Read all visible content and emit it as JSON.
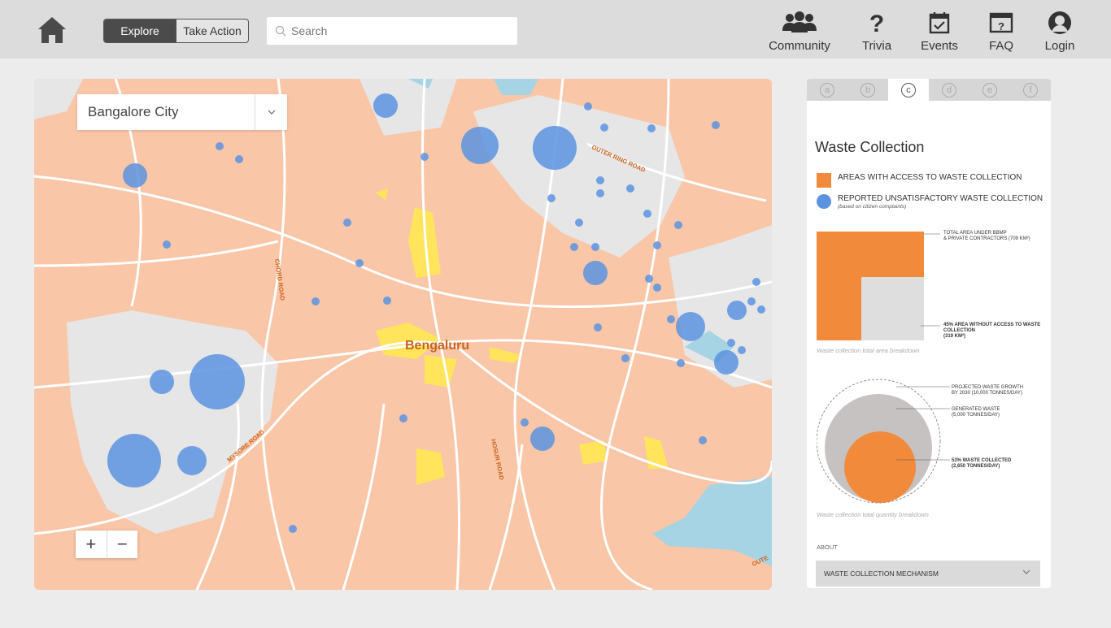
{
  "header": {
    "segment": {
      "explore": "Explore",
      "take_action": "Take Action"
    },
    "search_placeholder": "Search",
    "nav": [
      {
        "label": "Community",
        "icon": "community-icon"
      },
      {
        "label": "Trivia",
        "icon": "question-icon"
      },
      {
        "label": "Events",
        "icon": "calendar-icon"
      },
      {
        "label": "FAQ",
        "icon": "faq-icon"
      },
      {
        "label": "Login",
        "icon": "user-icon"
      }
    ]
  },
  "map": {
    "city_select": "Bangalore City",
    "city_label": "Bengaluru",
    "road_labels": [
      "OUTER RING ROAD",
      "CHORD ROAD",
      "MYSORE ROAD",
      "HOSUR ROAD",
      "OUTE"
    ],
    "zoom_in": "+",
    "zoom_out": "−",
    "colors": {
      "coverage": "#f9c6a8",
      "complaint": "#5b93e0",
      "park": "#ffe45c",
      "water": "#a6d4e4"
    }
  },
  "panel": {
    "steps": [
      "a",
      "b",
      "c",
      "d",
      "e",
      "f"
    ],
    "active_step": "c",
    "title": "Waste Collection",
    "legend": {
      "area": "AREAS WITH ACCESS TO WASTE COLLECTION",
      "reported": "REPORTED UNSATISFACTORY WASTE COLLECTION",
      "reported_sub": "(based on citizen complaints)"
    },
    "area_chart": {
      "total_line1": "TOTAL AREA UNDER BBMP",
      "total_line2": "& PRIVATE CONTRACTORS (709 KM²)",
      "without_line1": "45% AREA WITHOUT ACCESS TO WASTE",
      "without_line2": "COLLECTION",
      "without_line3": "(319 KM²)",
      "caption": "Waste collection total area breakdown"
    },
    "quantity_chart": {
      "projected_line1": "PROJECTED WASTE GROWTH",
      "projected_line2": "BY 2030 (10,000 TONNES/DAY)",
      "generated_line1": "GENERATED WASTE",
      "generated_line2": "(5,000 TONNES/DAY)",
      "collected_line1": "53% WASTE COLLECTED",
      "collected_line2": "(2,650 TONNES/DAY)",
      "caption": "Waste collection total quantity breakdown"
    },
    "about_label": "ABOUT",
    "accordion": "WASTE COLLECTION MECHANISM"
  }
}
